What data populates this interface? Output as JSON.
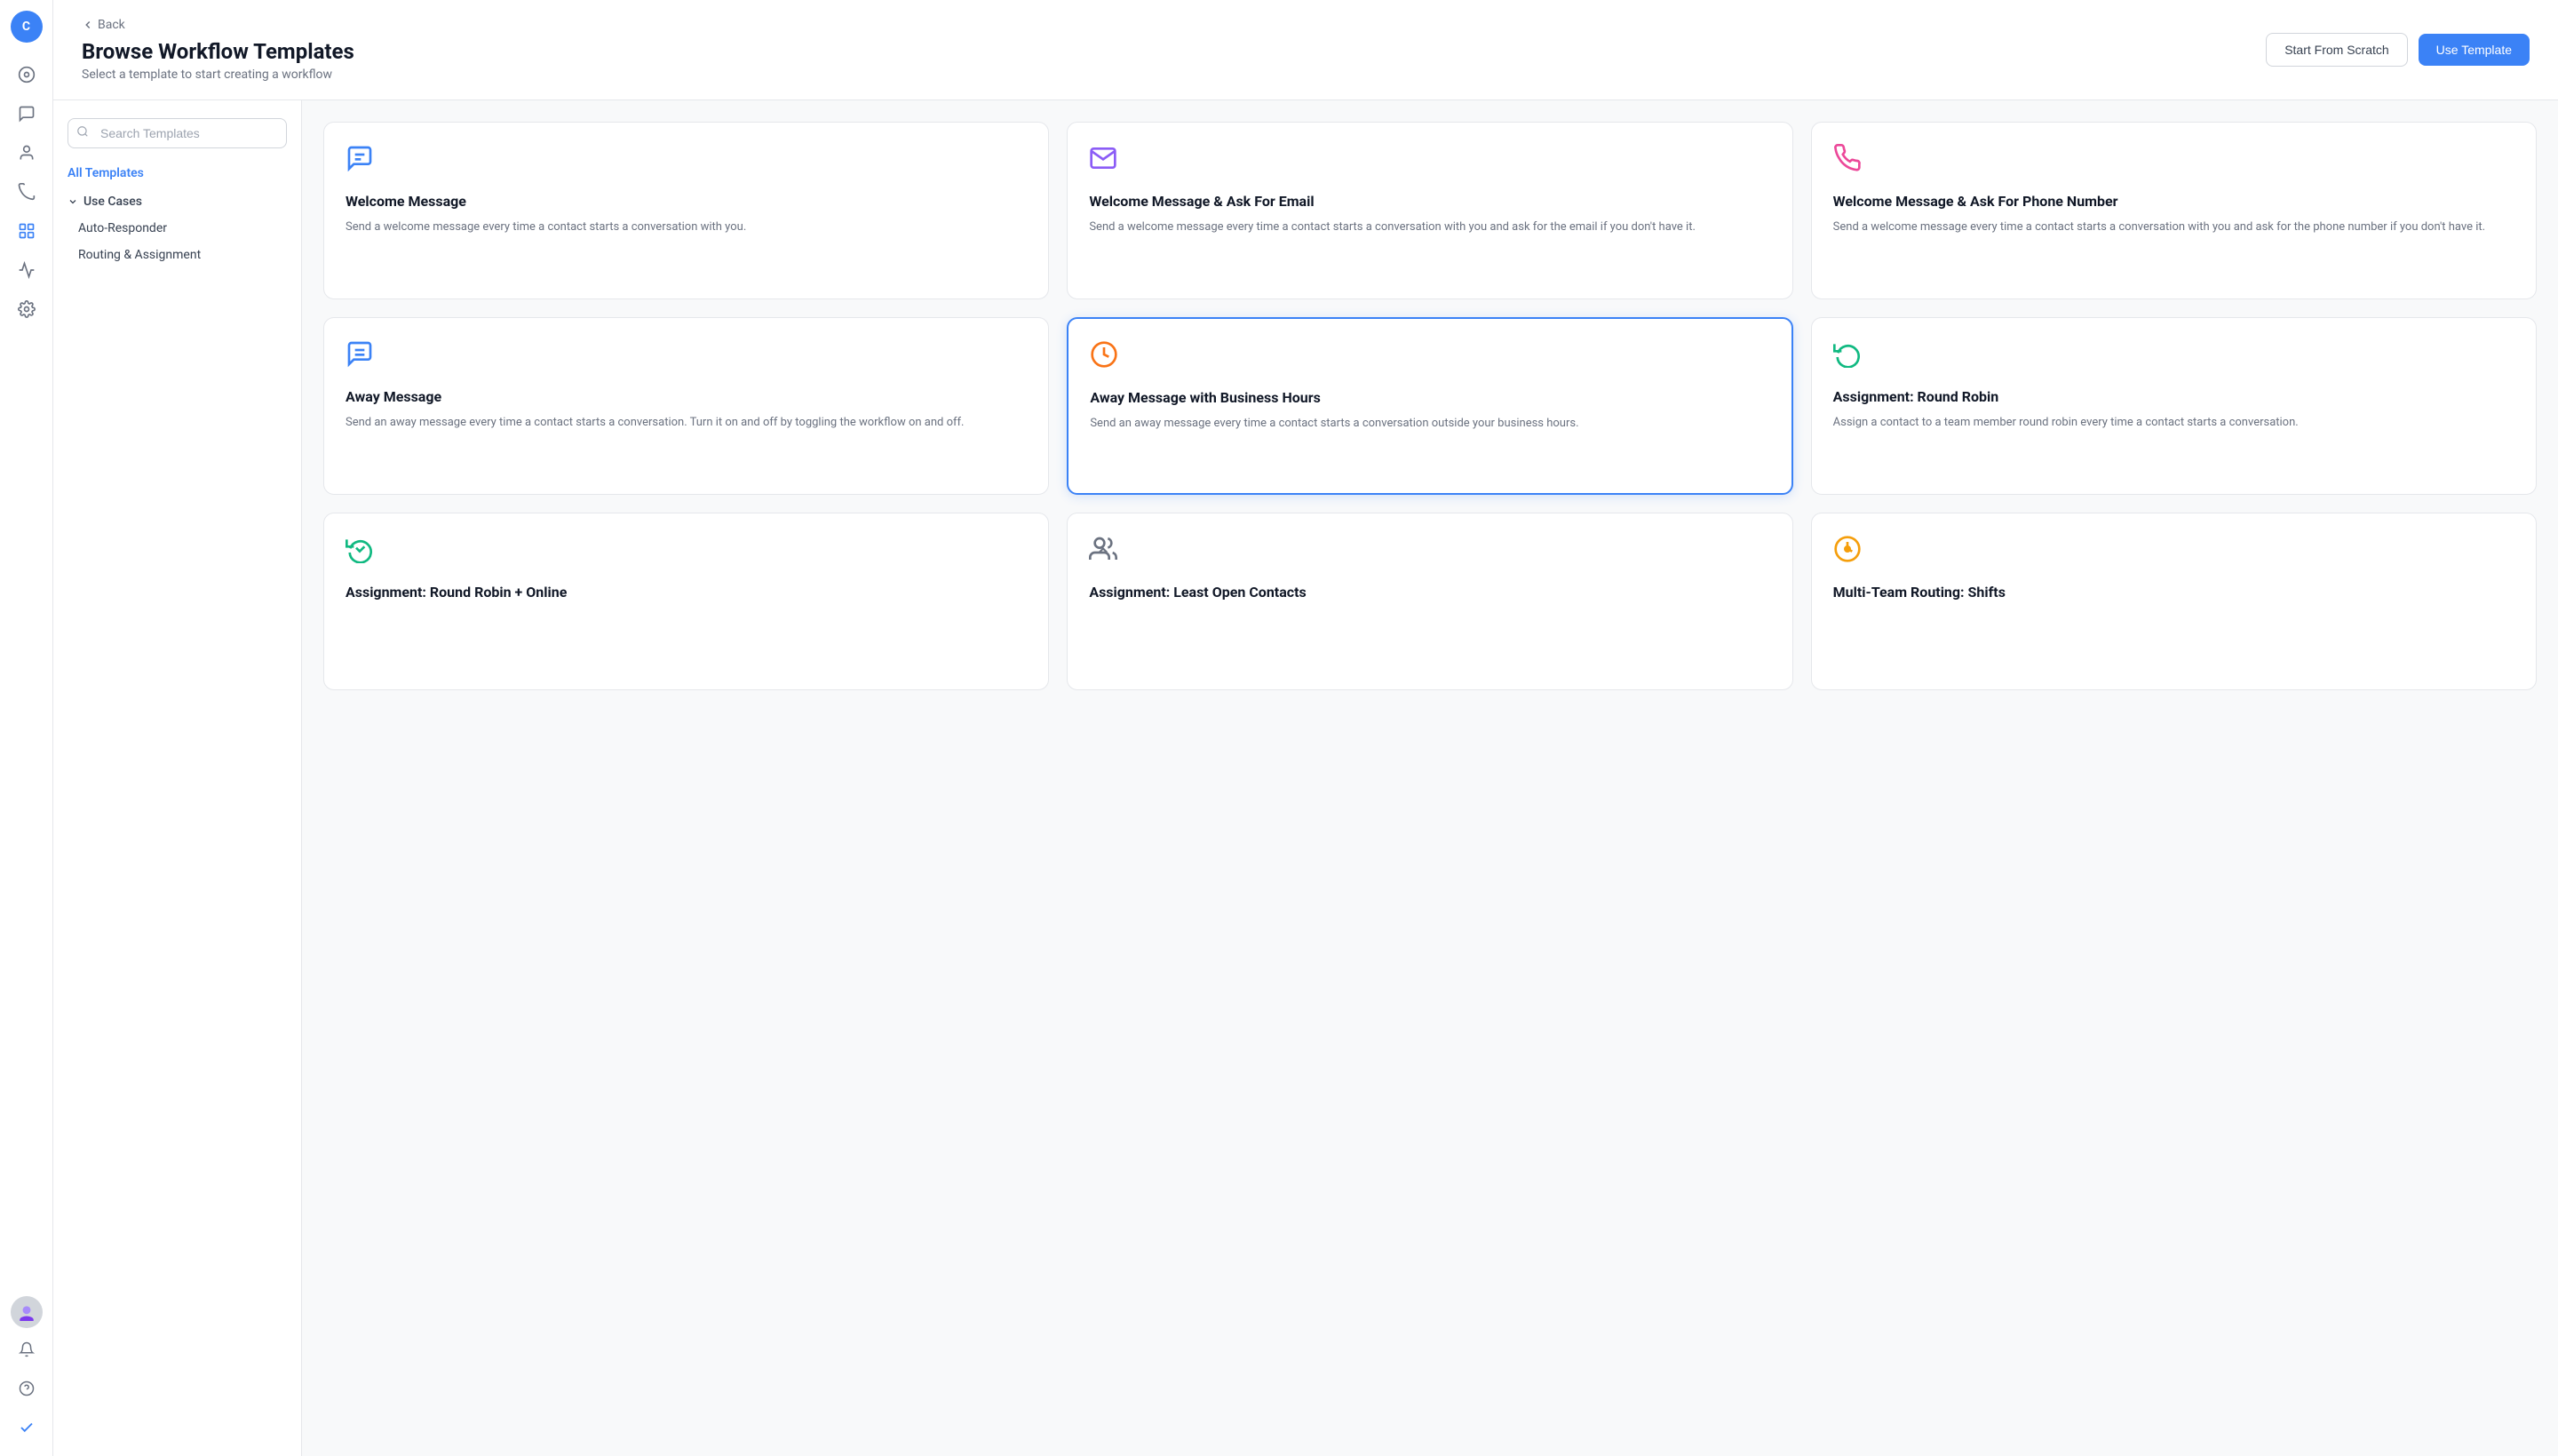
{
  "nav": {
    "avatar_initial": "C",
    "items": [
      {
        "name": "dashboard-icon",
        "icon": "⊙",
        "active": false
      },
      {
        "name": "chat-icon",
        "icon": "💬",
        "active": false
      },
      {
        "name": "contacts-icon",
        "icon": "👤",
        "active": false
      },
      {
        "name": "broadcast-icon",
        "icon": "📡",
        "active": false
      },
      {
        "name": "workflow-icon",
        "icon": "⬡",
        "active": true
      },
      {
        "name": "reports-icon",
        "icon": "📊",
        "active": false
      },
      {
        "name": "settings-icon",
        "icon": "⚙",
        "active": false
      }
    ],
    "bottom_items": [
      {
        "name": "help-icon",
        "icon": "?"
      },
      {
        "name": "notifications-icon",
        "icon": "🔔"
      },
      {
        "name": "checkmark-icon",
        "icon": "✔"
      }
    ]
  },
  "header": {
    "back_label": "Back",
    "title": "Browse Workflow Templates",
    "subtitle": "Select a template to start creating a workflow",
    "start_from_scratch_label": "Start From Scratch",
    "use_template_label": "Use Template"
  },
  "sidebar": {
    "search_placeholder": "Search Templates",
    "all_templates_label": "All Templates",
    "use_cases_label": "Use Cases",
    "items": [
      {
        "label": "Auto-Responder"
      },
      {
        "label": "Routing & Assignment"
      }
    ]
  },
  "templates": [
    {
      "id": "welcome-message",
      "icon_color": "#3b82f6",
      "icon_type": "message",
      "title": "Welcome Message",
      "description": "Send a welcome message every time a contact starts a conversation with you.",
      "selected": false
    },
    {
      "id": "welcome-email",
      "icon_color": "#8b5cf6",
      "icon_type": "email",
      "title": "Welcome Message & Ask For Email",
      "description": "Send a welcome message every time a contact starts a conversation with you and ask for the email if you don't have it.",
      "selected": false
    },
    {
      "id": "welcome-phone",
      "icon_color": "#ec4899",
      "icon_type": "phone",
      "title": "Welcome Message & Ask For Phone Number",
      "description": "Send a welcome message every time a contact starts a conversation with you and ask for the phone number if you don't have it.",
      "selected": false
    },
    {
      "id": "away-message",
      "icon_color": "#3b82f6",
      "icon_type": "away-message",
      "title": "Away Message",
      "description": "Send an away message every time a contact starts a conversation. Turn it on and off by toggling the workflow on and off.",
      "selected": false
    },
    {
      "id": "away-business-hours",
      "icon_color": "#f97316",
      "icon_type": "clock",
      "title": "Away Message with Business Hours",
      "description": "Send an away message every time a contact starts a conversation outside your business hours.",
      "selected": true
    },
    {
      "id": "round-robin",
      "icon_color": "#10b981",
      "icon_type": "rotate",
      "title": "Assignment: Round Robin",
      "description": "Assign a contact to a team member round robin every time a contact starts a conversation.",
      "selected": false
    },
    {
      "id": "round-robin-online",
      "icon_color": "#10b981",
      "icon_type": "rotate-check",
      "title": "Assignment: Round Robin + Online",
      "description": "",
      "selected": false
    },
    {
      "id": "least-open",
      "icon_color": "#6b7280",
      "icon_type": "contacts-arrow",
      "title": "Assignment: Least Open Contacts",
      "description": "",
      "selected": false
    },
    {
      "id": "multi-team",
      "icon_color": "#f59e0b",
      "icon_type": "timer",
      "title": "Multi-Team Routing: Shifts",
      "description": "",
      "selected": false
    }
  ],
  "colors": {
    "blue": "#3b82f6",
    "purple": "#8b5cf6",
    "pink": "#ec4899",
    "orange": "#f97316",
    "green": "#10b981",
    "amber": "#f59e0b",
    "gray": "#6b7280"
  }
}
